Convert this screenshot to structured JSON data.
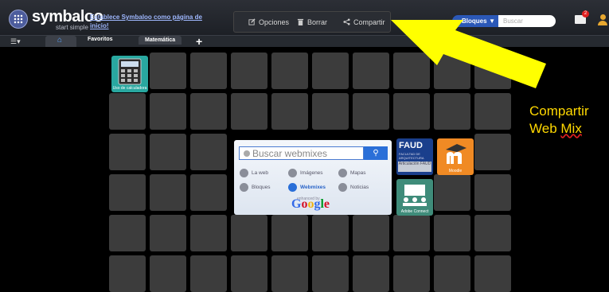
{
  "header": {
    "brand": "symbaloo",
    "tagline": "start simple",
    "promo_link": "Establece Symbaloo como página de inicio!"
  },
  "toolbar": {
    "options_label": "Opciones",
    "delete_label": "Borrar",
    "share_label": "Compartir"
  },
  "search_bar": {
    "scope_label": "Bloques",
    "placeholder": "Buscar"
  },
  "notifications": {
    "count": "2"
  },
  "tabs": {
    "favorites_label": "Favoritos",
    "math_label": "Matemática",
    "add_label": "+"
  },
  "widget": {
    "search_placeholder": "Buscar webmixes",
    "options": [
      {
        "label": "La web",
        "selected": false
      },
      {
        "label": "Imágenes",
        "selected": false
      },
      {
        "label": "Mapas",
        "selected": false
      },
      {
        "label": "Bloques",
        "selected": false
      },
      {
        "label": "Webmixes",
        "selected": true
      },
      {
        "label": "Noticias",
        "selected": false
      }
    ],
    "enhanced_by": "enhanced by",
    "provider": "Google"
  },
  "tiles": {
    "calculator": "Uso de calculadora",
    "faud_title": "FAUD",
    "faud_sub": "FACULTAD DE ARQUITECTURA",
    "faud_label": "Articulación FAUD",
    "moodle": "Moodle",
    "adobe": "Adobe Connect"
  },
  "callout": {
    "line1": "Compartir",
    "line2_a": "Web",
    "line2_b": "Mix"
  },
  "colors": {
    "arrow": "#ffff00",
    "callout_text": "#ffd800",
    "accent_blue": "#2a6fd8"
  }
}
